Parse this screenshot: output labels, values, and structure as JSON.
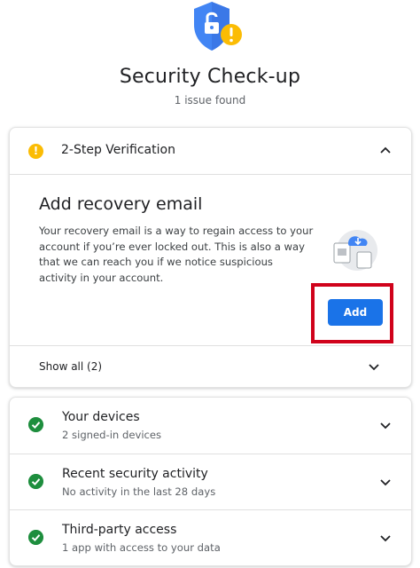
{
  "header": {
    "title": "Security Check-up",
    "subtitle": "1 issue found",
    "icon": "shield-lock-warning-icon"
  },
  "issue_card": {
    "section_title": "2-Step Verification",
    "section_icon": "warning-icon",
    "recovery": {
      "title": "Add recovery email",
      "body": "Your recovery email is a way to regain access to your account if you’re ever locked out. This is also a way that we can reach you if we notice suspicious activity in your account.",
      "add_label": "Add"
    },
    "show_all_label": "Show all (2)"
  },
  "status_rows": [
    {
      "title": "Your devices",
      "subtitle": "2 signed-in devices"
    },
    {
      "title": "Recent security activity",
      "subtitle": "No activity in the last 28 days"
    },
    {
      "title": "Third-party access",
      "subtitle": "1 app with access to your data"
    }
  ],
  "colors": {
    "accent_blue": "#1a73e8",
    "warning_yellow": "#fbbc04",
    "success_green": "#1e8e3e",
    "highlight_red": "#d0021b"
  }
}
